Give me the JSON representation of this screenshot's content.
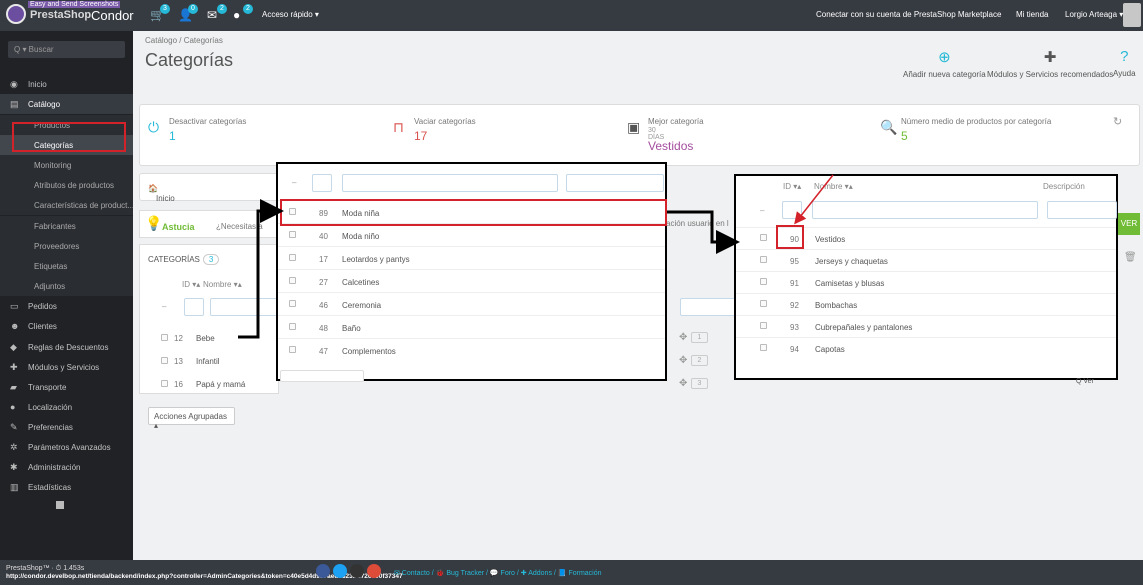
{
  "topbar": {
    "logo_text": "PrestaShop",
    "annotation": "Easy and Send Screenshots",
    "shop_name": "Condor",
    "badges": [
      "3",
      "0",
      "2",
      "2"
    ],
    "quick_access": "Acceso rápido ▾",
    "connect": "Conectar con su cuenta de PrestaShop Marketplace",
    "my_shop": "Mi tienda",
    "user": "Lorgio Arteaga ▾"
  },
  "sidebar": {
    "search_placeholder": "Q ▾  Buscar",
    "items": [
      {
        "label": "Inicio",
        "icon": "dashboard-icon",
        "glyph": "◉"
      },
      {
        "label": "Catálogo",
        "icon": "catalog-icon",
        "glyph": "▤"
      },
      {
        "label": "Productos"
      },
      {
        "label": "Categorías"
      },
      {
        "label": "Monitoring"
      },
      {
        "label": "Atributos de productos"
      },
      {
        "label": "Características de product..."
      },
      {
        "label": "Fabricantes"
      },
      {
        "label": "Proveedores"
      },
      {
        "label": "Etiquetas"
      },
      {
        "label": "Adjuntos"
      },
      {
        "label": "Pedidos",
        "icon": "orders-icon",
        "glyph": "▭"
      },
      {
        "label": "Clientes",
        "icon": "customers-icon",
        "glyph": "☻"
      },
      {
        "label": "Reglas de Descuentos",
        "icon": "discount-icon",
        "glyph": "◆"
      },
      {
        "label": "Módulos y Servicios",
        "icon": "modules-icon",
        "glyph": "✚"
      },
      {
        "label": "Transporte",
        "icon": "transport-icon",
        "glyph": "▰"
      },
      {
        "label": "Localización",
        "icon": "location-icon",
        "glyph": "●"
      },
      {
        "label": "Preferencias",
        "icon": "preferences-icon",
        "glyph": "✎"
      },
      {
        "label": "Parámetros Avanzados",
        "icon": "advanced-icon",
        "glyph": "✲"
      },
      {
        "label": "Administración",
        "icon": "admin-icon",
        "glyph": "✱"
      },
      {
        "label": "Estadísticas",
        "icon": "stats-icon",
        "glyph": "▥"
      }
    ]
  },
  "page": {
    "breadcrumb": "Catálogo  /  Categorías",
    "title": "Categorías",
    "toolbar": {
      "add": "Añadir nueva categoría",
      "modules": "Módulos y Servicios recomendados",
      "help": "Ayuda"
    }
  },
  "kpis": [
    {
      "label": "Desactivar categorías",
      "value": "1",
      "color": "#25b9d7"
    },
    {
      "label": "Vaciar categorías",
      "value": "17",
      "color": "#d9534f"
    },
    {
      "label": "Mejor categoría",
      "sub": "30 DÍAS",
      "value": "Vestidos",
      "color": "#a54e9f"
    },
    {
      "label": "Número medio de productos por categoría",
      "value": "5",
      "color": "#71bc37"
    }
  ],
  "home_label": "Inicio",
  "hint": {
    "label": "Astucia",
    "question": "¿Necesitas a",
    "right_text": "ación usuario en l"
  },
  "categories": {
    "header": "CATEGORÍAS",
    "count": "3",
    "col_id": "ID ▾▴",
    "col_name": "Nombre ▾▴",
    "rows": [
      {
        "id": "12",
        "name": "Bebe",
        "position": "1"
      },
      {
        "id": "13",
        "name": "Infantil",
        "position": "2"
      },
      {
        "id": "16",
        "name": "Papá y mamá",
        "position": "3"
      }
    ],
    "bulk": "Acciones Agrupadas ▴"
  },
  "popup1": {
    "rows": [
      {
        "id": "89",
        "name": "Moda niña"
      },
      {
        "id": "40",
        "name": "Moda niño"
      },
      {
        "id": "17",
        "name": "Leotardos y pantys"
      },
      {
        "id": "27",
        "name": "Calcetines"
      },
      {
        "id": "46",
        "name": "Ceremonia"
      },
      {
        "id": "48",
        "name": "Baño"
      },
      {
        "id": "47",
        "name": "Complementos"
      }
    ]
  },
  "popup2": {
    "col_id": "ID ▾▴",
    "col_name": "Nombre ▾▴",
    "col_desc": "Descripción",
    "rows": [
      {
        "id": "90",
        "name": "Vestidos"
      },
      {
        "id": "95",
        "name": "Jerseys y chaquetas"
      },
      {
        "id": "91",
        "name": "Camisetas y blusas"
      },
      {
        "id": "92",
        "name": "Bombachas"
      },
      {
        "id": "93",
        "name": "Cubrepañales y pantalones"
      },
      {
        "id": "94",
        "name": "Capotas"
      }
    ],
    "search_btn": "Q Ver"
  },
  "footer": {
    "version": "PrestaShop™ · ⏱ 1.453s",
    "url": "http://condor.develbop.net/tienda/backend/index.php?controller=AdminCategories&token=c40e5d4d937aed9523bd726700f37347",
    "links": "✉ Contacto / 🐞 Bug Tracker / 💬 Foro / ✚ Addons / 📘 Formación"
  },
  "colors": {
    "accent": "#25b9d7",
    "highlight": "#d4222a",
    "success": "#71bc37"
  }
}
